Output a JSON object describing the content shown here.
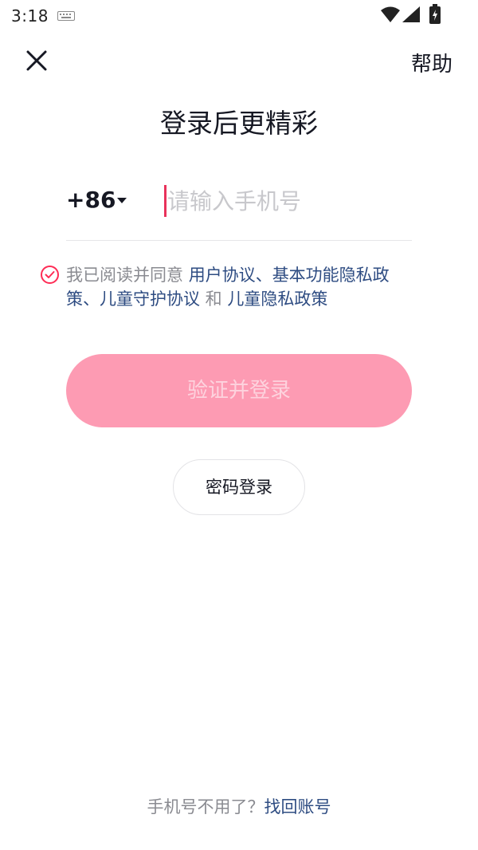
{
  "status_bar": {
    "time": "3:18",
    "icons": [
      "keyboard-icon",
      "wifi-icon",
      "signal-icon",
      "battery-icon"
    ]
  },
  "header": {
    "close_icon": "close-icon",
    "help_label": "帮助"
  },
  "title": "登录后更精彩",
  "phone": {
    "country_code": "+86",
    "placeholder": "请输入手机号",
    "value": ""
  },
  "agreement": {
    "checked": true,
    "prefix": "我已阅读并同意 ",
    "user_agreement": "用户协议",
    "sep1": "、",
    "privacy_policy": "基本功能隐私政策",
    "sep2": "、",
    "child_protection": "儿童守护协议",
    "and": " 和 ",
    "child_privacy": "儿童隐私政策"
  },
  "buttons": {
    "verify_login": "验证并登录",
    "password_login": "密码登录"
  },
  "footer": {
    "question": "手机号不用了？",
    "recover_link": "找回账号"
  },
  "colors": {
    "accent": "#fe2c55",
    "button_disabled_bg": "#fd9bb3",
    "link": "#2e4c82"
  }
}
